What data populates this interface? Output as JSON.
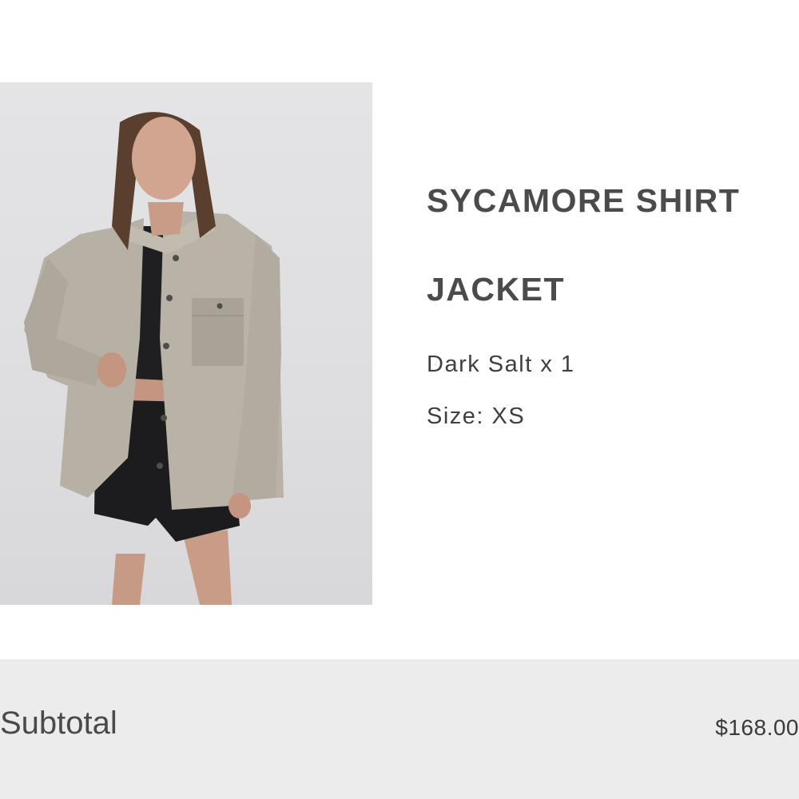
{
  "product": {
    "title": "SYCAMORE SHIRT JACKET",
    "variant_line": "Dark Salt x 1",
    "size_line": "Size: XS",
    "image_alt": "model-wearing-sycamore-shirt-jacket"
  },
  "summary": {
    "subtotal_label": "Subtotal",
    "subtotal_value": "$168.00"
  }
}
